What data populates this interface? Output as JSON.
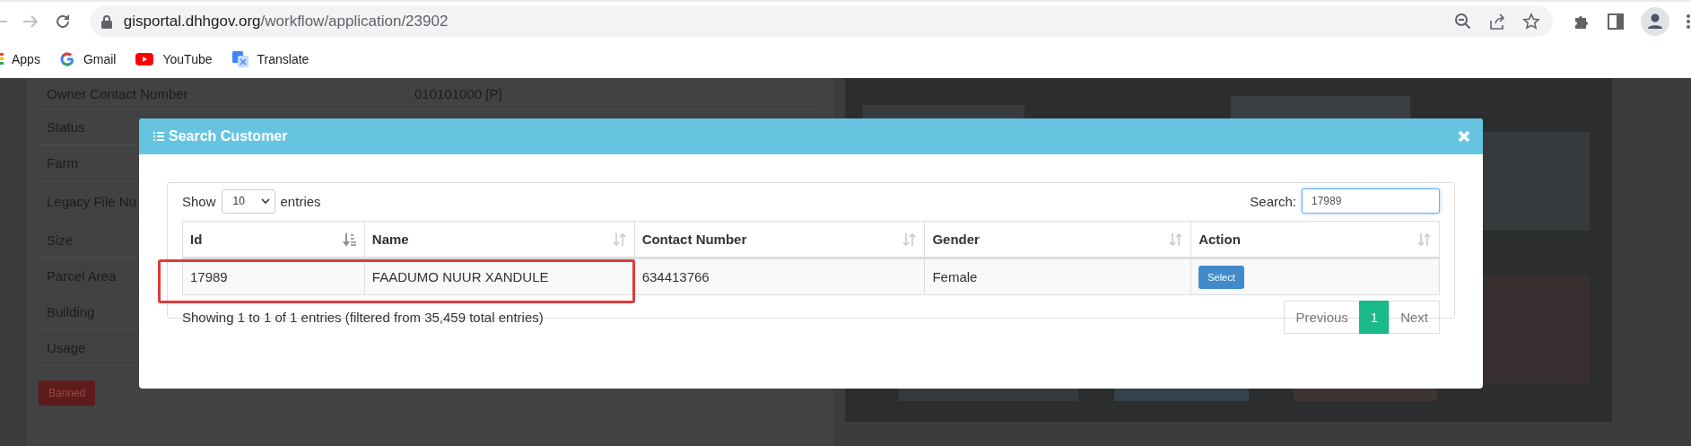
{
  "browser": {
    "url": {
      "domain": "gisportal.dhhgov.org",
      "path": "/workflow/application/23902"
    },
    "bookmarks": [
      {
        "label": "Apps",
        "kind": "apps"
      },
      {
        "label": "Gmail",
        "kind": "gmail"
      },
      {
        "label": "YouTube",
        "kind": "youtube"
      },
      {
        "label": "Translate",
        "kind": "translate"
      }
    ]
  },
  "page": {
    "details": [
      {
        "label": "Owner Contact Number",
        "value": "010101000 [P]"
      },
      {
        "label": "Status"
      },
      {
        "label": "Farm"
      },
      {
        "label": "Legacy File Nu"
      },
      {
        "label": "Size"
      },
      {
        "label": "Parcel Area"
      },
      {
        "label": "Building"
      },
      {
        "label": "Usage"
      }
    ],
    "status_button": "Banned"
  },
  "modal": {
    "title": "Search Customer",
    "length_prefix": "Show",
    "length_value": "10",
    "length_suffix": "entries",
    "search_label": "Search:",
    "search_value": "17989",
    "columns": [
      {
        "label": "Id",
        "sorted": true
      },
      {
        "label": "Name",
        "sorted": false
      },
      {
        "label": "Contact Number",
        "sorted": false
      },
      {
        "label": "Gender",
        "sorted": false
      },
      {
        "label": "Action",
        "sorted": false
      }
    ],
    "rows": [
      {
        "cells": [
          "17989",
          "FAADUMO NUUR XANDULE",
          "634413766",
          "Female"
        ],
        "action": "Select",
        "highlighted": true
      }
    ],
    "info": "Showing 1 to 1 of 1 entries (filtered from 35,459 total entries)",
    "pagination": [
      {
        "label": "Previous",
        "selected": false
      },
      {
        "label": "1",
        "selected": true
      },
      {
        "label": "Next",
        "selected": false
      }
    ]
  }
}
